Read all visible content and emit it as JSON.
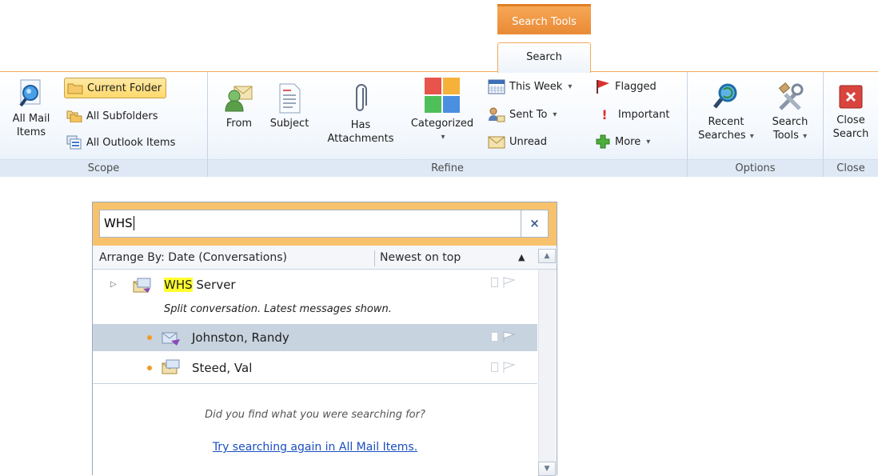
{
  "ribbon": {
    "contextual_tab": "Search Tools",
    "active_tab": "Search",
    "groups": {
      "scope": {
        "label": "Scope",
        "all_mail_items": [
          "All Mail",
          "Items"
        ],
        "current_folder": "Current Folder",
        "all_subfolders": "All Subfolders",
        "all_outlook_items": "All Outlook Items"
      },
      "refine": {
        "label": "Refine",
        "from": "From",
        "subject": "Subject",
        "has_attachments": [
          "Has",
          "Attachments"
        ],
        "categorized": "Categorized",
        "this_week": "This Week",
        "sent_to": "Sent To",
        "unread": "Unread",
        "flagged": "Flagged",
        "important": "Important",
        "more": "More"
      },
      "options": {
        "label": "Options",
        "recent_searches": [
          "Recent",
          "Searches"
        ],
        "search_tools": [
          "Search",
          "Tools"
        ]
      },
      "close": {
        "label": "Close",
        "close_search": [
          "Close",
          "Search"
        ]
      }
    }
  },
  "search": {
    "query": "WHS",
    "arrange_by": "Arrange By: Date (Conversations)",
    "sort_order": "Newest on top",
    "conversation": {
      "highlight": "WHS",
      "rest": " Server",
      "note": "Split conversation. Latest messages shown."
    },
    "messages": [
      {
        "sender": "Johnston, Randy",
        "selected": true
      },
      {
        "sender": "Steed, Val",
        "selected": false
      }
    ],
    "found_prompt": "Did you find what you were searching for?",
    "retry_link": "Try searching again in All Mail Items."
  },
  "colors": {
    "accent_orange": "#f29a28",
    "search_bar": "#f8c26c",
    "selection": "#c8d3e0",
    "link": "#1a4fbf"
  }
}
